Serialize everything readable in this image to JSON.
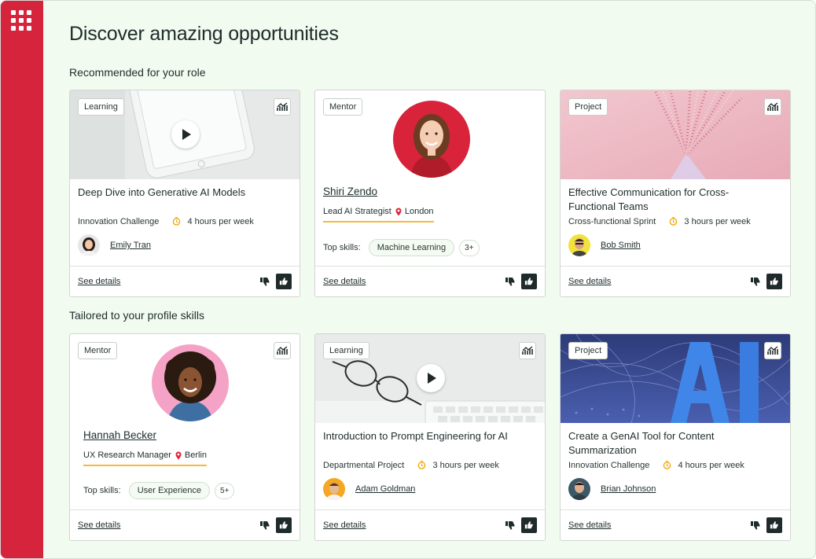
{
  "header": {
    "title": "Discover amazing opportunities"
  },
  "sections": {
    "recommended": "Recommended for your role",
    "tailored": "Tailored to your profile skills"
  },
  "footer_labels": {
    "see_details": "See details"
  },
  "skills_label": "Top skills:",
  "colors": {
    "rail": "#d6243c",
    "background": "#f2fbf0",
    "underline": "#f4b93d"
  },
  "cards": [
    {
      "tag": "Learning",
      "title": "Deep Dive into Generative AI Models",
      "program": "Innovation Challenge",
      "time": "4 hours per week",
      "person": "Emily Tran"
    },
    {
      "tag": "Mentor",
      "name": "Shiri Zendo",
      "role": "Lead AI Strategist",
      "location": "London",
      "skill": "Machine Learning",
      "more": "3+"
    },
    {
      "tag": "Project",
      "title": "Effective Communication for Cross-Functional Teams",
      "program": "Cross-functional Sprint",
      "time": "3 hours per week",
      "person": "Bob Smith"
    },
    {
      "tag": "Mentor",
      "name": "Hannah Becker",
      "role": "UX Research Manager",
      "location": "Berlin",
      "skill": "User Experience",
      "more": "5+"
    },
    {
      "tag": "Learning",
      "title": "Introduction to Prompt Engineering for AI",
      "program": "Departmental Project",
      "time": "3 hours per week",
      "person": "Adam Goldman"
    },
    {
      "tag": "Project",
      "title": "Create a GenAI Tool for Content Summarization",
      "program": "Innovation Challenge",
      "time": "4 hours per week",
      "person": "Brian Johnson"
    }
  ],
  "icons": [
    "apps-grid-icon",
    "trend-chart-icon",
    "play-icon",
    "clock-icon",
    "location-pin-icon",
    "thumbs-down-icon",
    "thumbs-up-icon"
  ]
}
